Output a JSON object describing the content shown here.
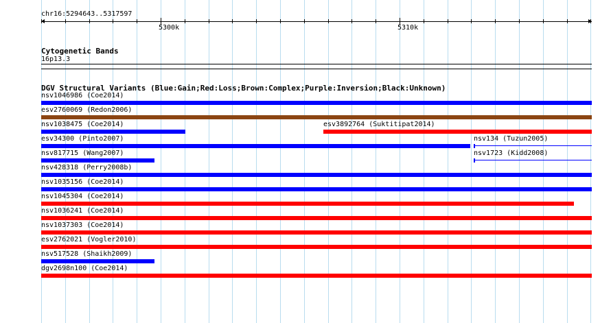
{
  "ruler": {
    "range_label": "chr16:5294643..5317597",
    "major_labels": [
      "5300k",
      "5310k"
    ]
  },
  "cytoband": {
    "title": "Cytogenetic Bands",
    "band": "16p13.3"
  },
  "dgv": {
    "title": "DGV Structural Variants (Blue:Gain;Red:Loss;Brown:Complex;Purple:Inversion;Black:Unknown)",
    "colors": {
      "gain": "#0000ff",
      "loss": "#ff0000",
      "complex": "#8b4513"
    },
    "features": [
      {
        "label": "nsv1046986 (Coe2014)",
        "type": "gain"
      },
      {
        "label": "esv2760069 (Redon2006)",
        "type": "complex"
      },
      {
        "label": "nsv1038475 (Coe2014)",
        "type": "gain"
      },
      {
        "label": "esv3892764 (Suktitipat2014)",
        "type": "loss"
      },
      {
        "label": "esv34300 (Pinto2007)",
        "type": "gain"
      },
      {
        "label": "nsv134 (Tuzun2005)",
        "type": "gain"
      },
      {
        "label": "nsv817715 (Wang2007)",
        "type": "gain"
      },
      {
        "label": "nsv1723 (Kidd2008)",
        "type": "gain"
      },
      {
        "label": "nsv428318 (Perry2008b)",
        "type": "gain"
      },
      {
        "label": "nsv1035156 (Coe2014)",
        "type": "gain"
      },
      {
        "label": "nsv1045304 (Coe2014)",
        "type": "loss"
      },
      {
        "label": "nsv1036241 (Coe2014)",
        "type": "loss"
      },
      {
        "label": "nsv1037303 (Coe2014)",
        "type": "loss"
      },
      {
        "label": "esv2762021 (Vogler2010)",
        "type": "loss"
      },
      {
        "label": "nsv517528 (Shaikh2009)",
        "type": "gain"
      },
      {
        "label": "dgv2698n100 (Coe2014)",
        "type": "loss"
      }
    ]
  }
}
